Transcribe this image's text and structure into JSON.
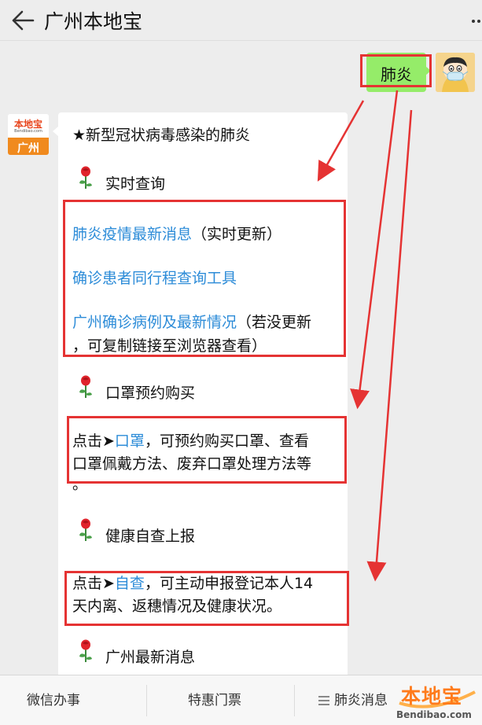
{
  "header": {
    "title": "广州本地宝"
  },
  "chat": {
    "user_message": "肺炎",
    "bot_avatar": {
      "name": "本地宝",
      "sub": "Bendibao.com",
      "city": "广州"
    },
    "bot_message": {
      "intro": "★新型冠状病毒感染的肺炎",
      "sections": [
        {
          "heading": "实时查询",
          "lines": [
            {
              "link": "肺炎疫情最新消息",
              "text": "（实时更新）"
            },
            {
              "link": "确诊患者同行程查询工具",
              "text": ""
            },
            {
              "link": "广州确诊病例及最新情况",
              "text": "（若没更新"
            },
            {
              "link": "",
              "text": "，可复制链接至浏览器查看）"
            }
          ]
        },
        {
          "heading": "口罩预约购买",
          "lines": [
            {
              "prefix": "点击➤",
              "link": "口罩",
              "text": "，可预约购买口罩、查看"
            },
            {
              "text": "口罩佩戴方法、废弃口罩处理方法等"
            },
            {
              "text": "。"
            }
          ]
        },
        {
          "heading": "健康自查上报",
          "lines": [
            {
              "prefix": "点击➤",
              "link": "自查",
              "text": "，可主动申报登记本人14"
            },
            {
              "text": "天内离、返穗情况及健康状况。"
            }
          ]
        },
        {
          "heading": "广州最新消息",
          "lines": []
        }
      ]
    }
  },
  "bottom_menu": {
    "items": [
      "微信办事",
      "特惠门票",
      "肺炎消息"
    ]
  },
  "watermark": {
    "text": "本地宝",
    "url": "Bendibao.com"
  },
  "colors": {
    "background": "#ededed",
    "user_bubble": "#95ec69",
    "link": "#2d8cd8",
    "highlight": "#e53333",
    "watermark": "#ff7b1c"
  }
}
